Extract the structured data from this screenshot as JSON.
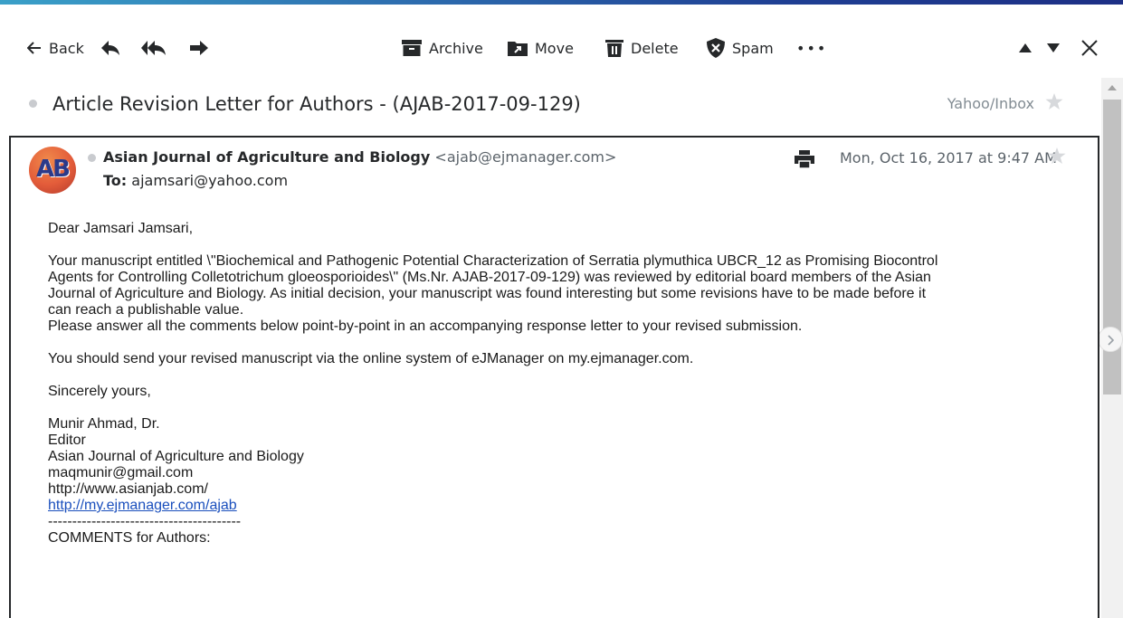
{
  "toolbar": {
    "back_label": "Back",
    "archive_label": "Archive",
    "move_label": "Move",
    "delete_label": "Delete",
    "spam_label": "Spam",
    "more_label": "•••"
  },
  "subject": {
    "text": "Article Revision Letter for Authors - (AJAB-2017-09-129)",
    "folder": "Yahoo/Inbox"
  },
  "message": {
    "avatar_text": "AB",
    "sender_name": "Asian Journal of Agriculture and Biology",
    "sender_email": "<ajab@ejmanager.com>",
    "to_label": "To:",
    "to_address": "ajamsari@yahoo.com",
    "date": "Mon, Oct 16, 2017 at 9:47 AM",
    "body": {
      "greeting": "Dear Jamsari Jamsari,",
      "para1_line1": "Your manuscript entitled \\\"Biochemical and Pathogenic Potential Characterization of Serratia plymuthica UBCR_12 as Promising Biocontrol",
      "para1_line2": "Agents for Controlling Colletotrichum gloeosporioides\\\" (Ms.Nr. AJAB-2017-09-129) was reviewed by editorial board members of the Asian",
      "para1_line3": "Journal of Agriculture and Biology. As initial decision, your manuscript was found interesting but some revisions have to be made before it",
      "para1_line4": "can reach a publishable value.",
      "para2": "Please answer all the comments below point-by-point in an accompanying response letter to your revised submission.",
      "para3": "You should send your revised manuscript via the online system of eJManager on my.ejmanager.com.",
      "closing": "Sincerely yours,",
      "sig_name": "Munir Ahmad, Dr.",
      "sig_title": "Editor",
      "sig_org": "Asian Journal of Agriculture and Biology",
      "sig_email": "maqmunir@gmail.com",
      "sig_site": "http://www.asianjab.com/",
      "sig_link": "http://my.ejmanager.com/ajab",
      "divider": "----------------------------------------",
      "comments_heading": "COMMENTS for Authors:"
    }
  },
  "colors": {
    "text": "#26282a",
    "muted": "#828c93",
    "link": "#1a4fbd"
  }
}
